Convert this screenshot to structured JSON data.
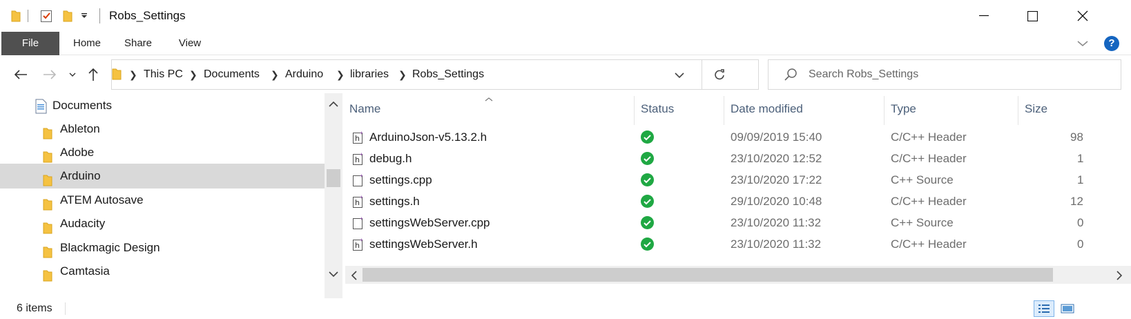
{
  "window": {
    "title": "Robs_Settings"
  },
  "ribbon": {
    "tabs": [
      "File",
      "Home",
      "Share",
      "View"
    ],
    "help": "?"
  },
  "address": {
    "crumbs": [
      "This PC",
      "Documents",
      "Arduino",
      "libraries",
      "Robs_Settings"
    ]
  },
  "search": {
    "placeholder": "Search Robs_Settings"
  },
  "tree": {
    "items": [
      {
        "label": "Documents",
        "icon": "documents-icon",
        "selected": false
      },
      {
        "label": "Ableton",
        "icon": "folder-icon",
        "selected": false
      },
      {
        "label": "Adobe",
        "icon": "folder-icon",
        "selected": false
      },
      {
        "label": "Arduino",
        "icon": "folder-icon",
        "selected": true
      },
      {
        "label": "ATEM Autosave",
        "icon": "folder-icon",
        "selected": false
      },
      {
        "label": "Audacity",
        "icon": "folder-icon",
        "selected": false
      },
      {
        "label": "Blackmagic Design",
        "icon": "folder-icon",
        "selected": false
      },
      {
        "label": "Camtasia",
        "icon": "folder-icon",
        "selected": false
      }
    ]
  },
  "files": {
    "columns": [
      "Name",
      "Status",
      "Date modified",
      "Type",
      "Size"
    ],
    "rows": [
      {
        "name": "ArduinoJson-v5.13.2.h",
        "icon": "c-header-file-icon",
        "status": "synced",
        "modified": "09/09/2019 15:40",
        "type": "C/C++ Header",
        "size": "98"
      },
      {
        "name": "debug.h",
        "icon": "c-header-file-icon",
        "status": "synced",
        "modified": "23/10/2020 12:52",
        "type": "C/C++ Header",
        "size": "1"
      },
      {
        "name": "settings.cpp",
        "icon": "cpp-source-file-icon",
        "status": "synced",
        "modified": "23/10/2020 17:22",
        "type": "C++ Source",
        "size": "1"
      },
      {
        "name": "settings.h",
        "icon": "c-header-file-icon",
        "status": "synced",
        "modified": "29/10/2020 10:48",
        "type": "C/C++ Header",
        "size": "12"
      },
      {
        "name": "settingsWebServer.cpp",
        "icon": "cpp-source-file-icon",
        "status": "synced",
        "modified": "23/10/2020 11:32",
        "type": "C++ Source",
        "size": "0"
      },
      {
        "name": "settingsWebServer.h",
        "icon": "c-header-file-icon",
        "status": "synced",
        "modified": "23/10/2020 11:32",
        "type": "C/C++ Header",
        "size": "0"
      }
    ]
  },
  "statusbar": {
    "count": "6 items"
  },
  "colors": {
    "selected": "#d9d9d9",
    "status_ok": "#1fa843",
    "column_header": "#4c607a",
    "file_tab": "#505050",
    "help": "#1565c0"
  }
}
